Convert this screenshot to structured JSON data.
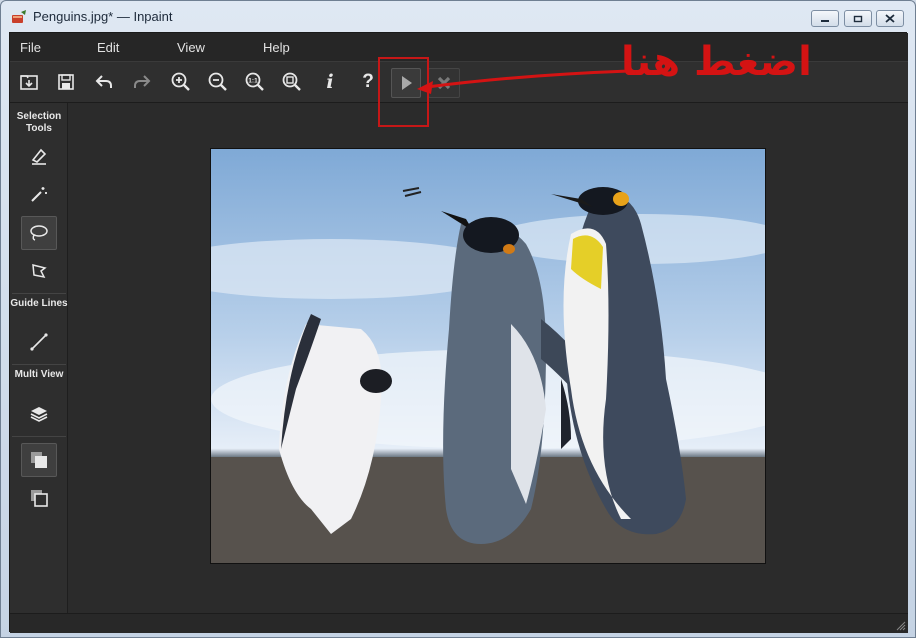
{
  "window": {
    "title": "Penguins.jpg* — Inpaint"
  },
  "menu": [
    {
      "label": "File"
    },
    {
      "label": "Edit"
    },
    {
      "label": "View"
    },
    {
      "label": "Help"
    }
  ],
  "toolbar": {
    "buttons": [
      {
        "icon": "open-icon"
      },
      {
        "icon": "save-icon"
      },
      {
        "icon": "undo-icon"
      },
      {
        "icon": "redo-icon"
      },
      {
        "icon": "zoom-in-icon"
      },
      {
        "icon": "zoom-out-icon"
      },
      {
        "icon": "actual-size-icon",
        "text": "1:1"
      },
      {
        "icon": "fit-window-icon"
      },
      {
        "icon": "info-icon",
        "text": "i"
      },
      {
        "icon": "help-icon",
        "text": "?"
      },
      {
        "icon": "play-icon"
      },
      {
        "icon": "cancel-icon"
      }
    ]
  },
  "sidebar": {
    "selection_tools": "Selection Tools",
    "guide_lines": "Guide Lines",
    "multi_view": "Multi View"
  },
  "annotation": {
    "text": "اضغط هنا",
    "color": "#d41313"
  },
  "colors": {
    "client_bg": "#2b2b2b",
    "toolbar_bg": "#2f2f2f",
    "titlebar_bg": "#dfe8f3"
  }
}
